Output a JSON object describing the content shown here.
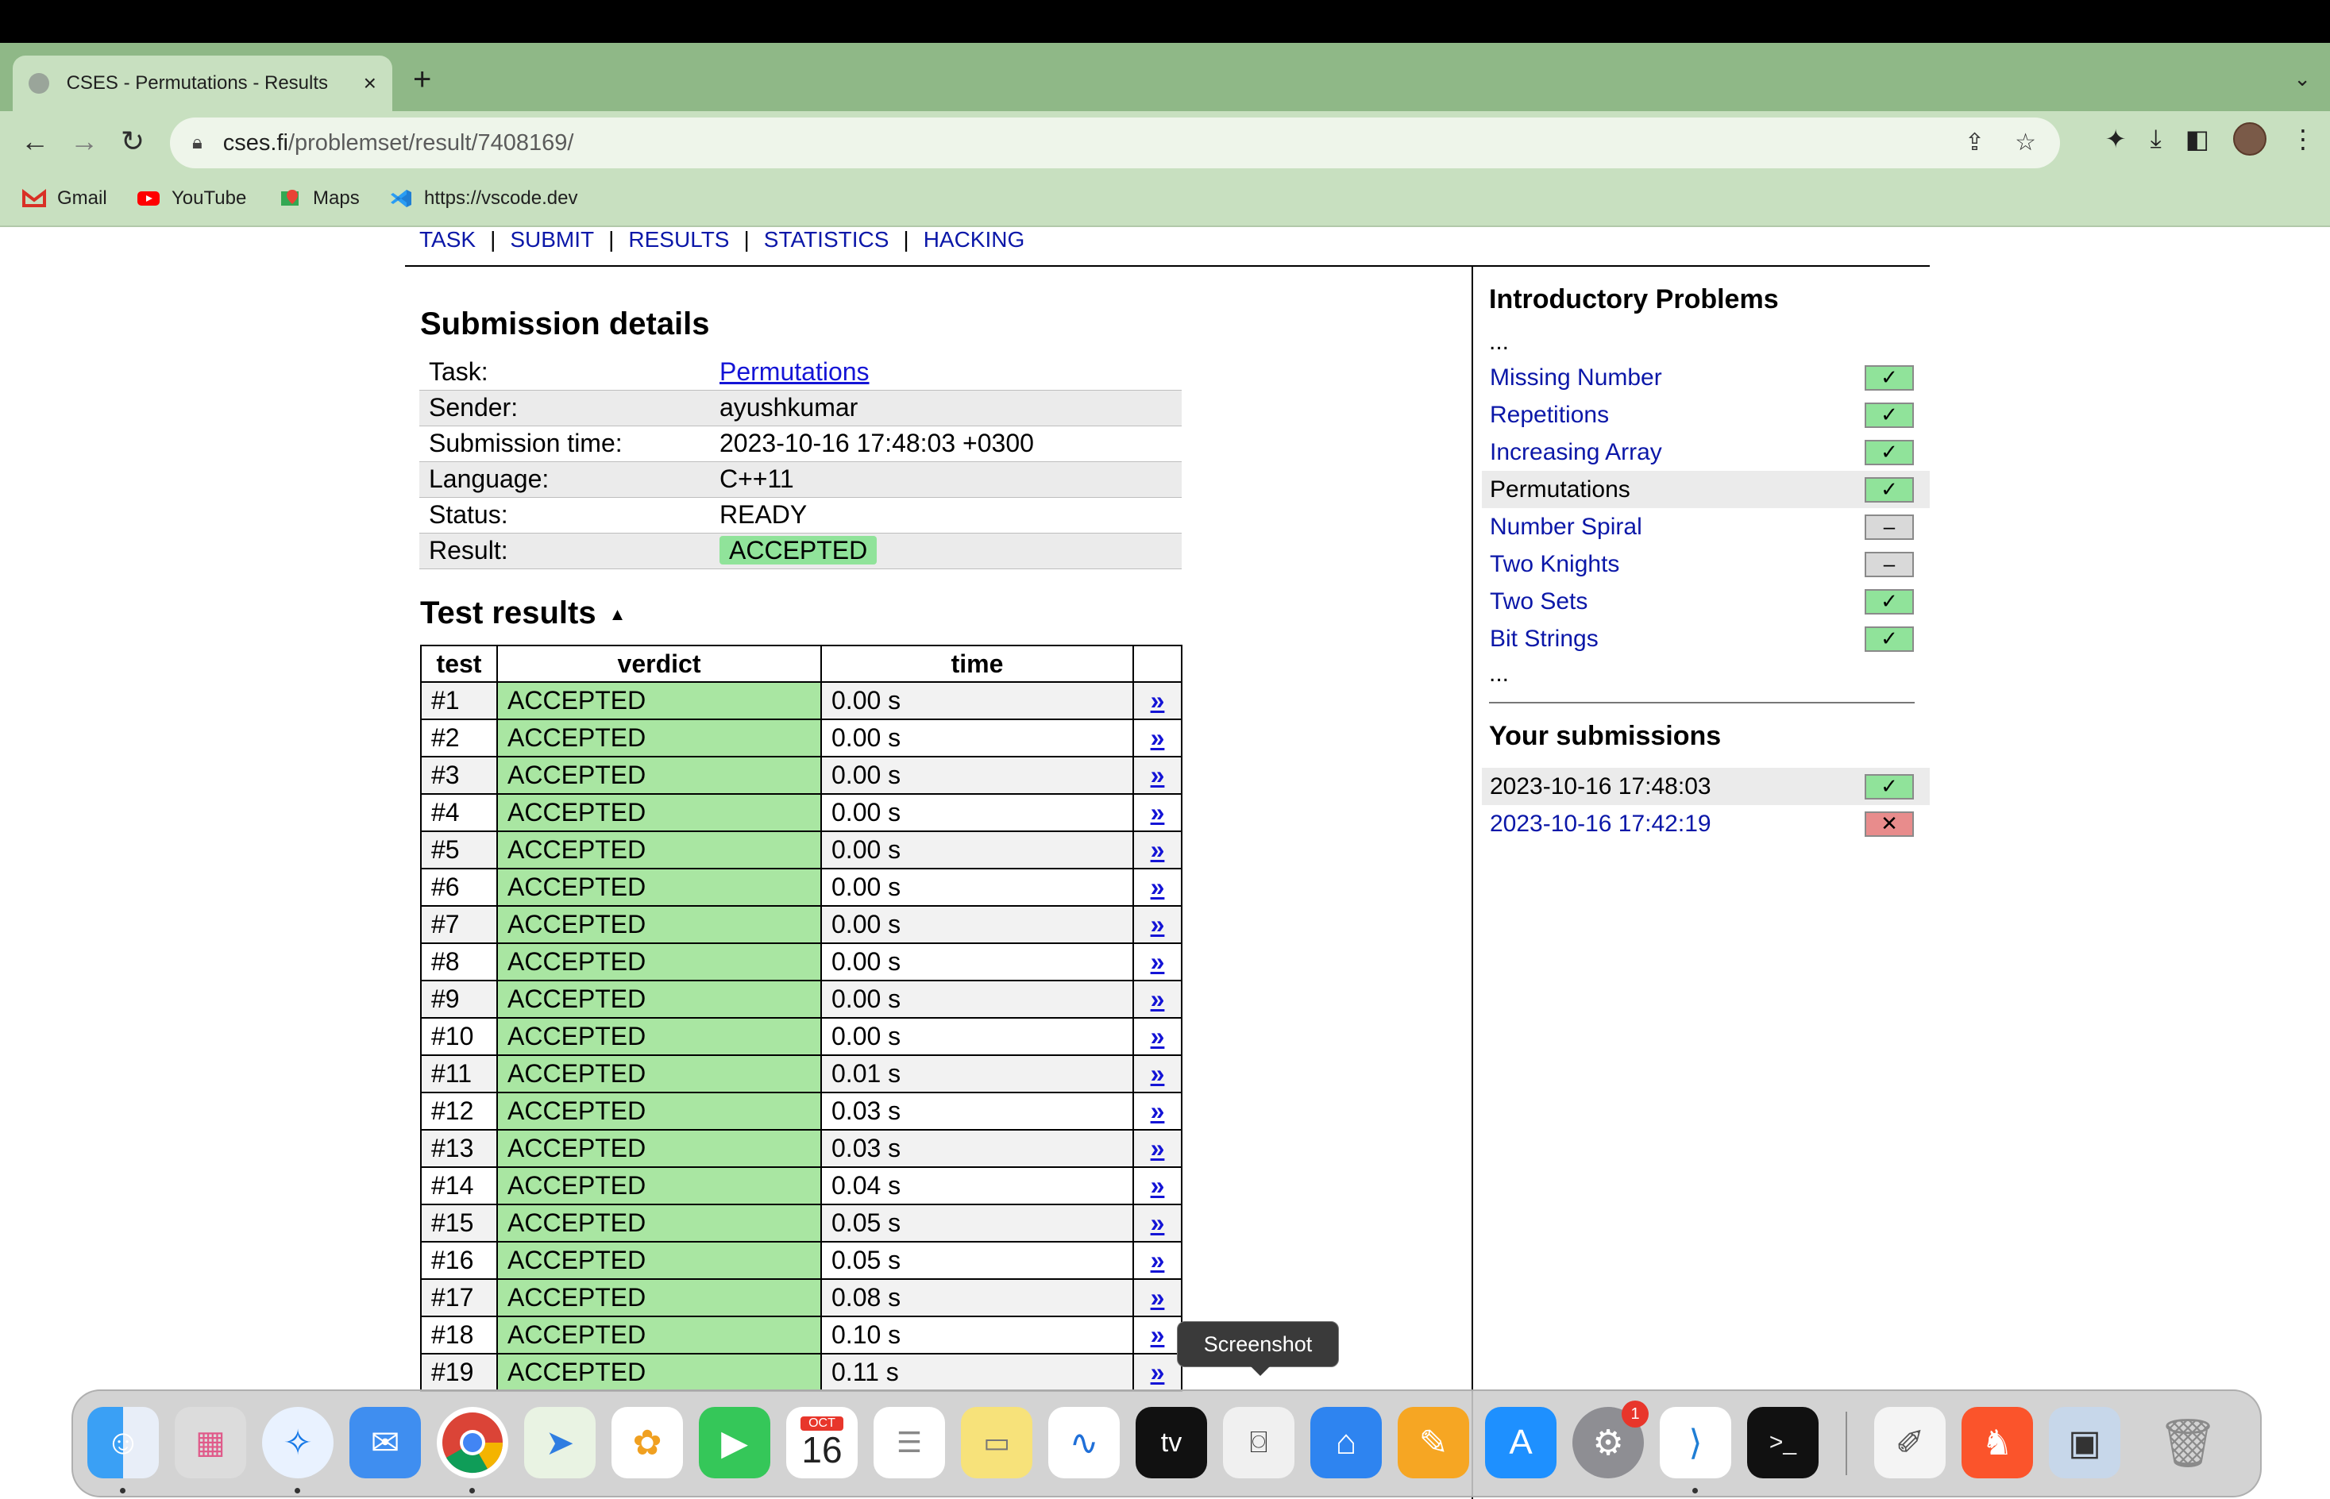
{
  "browser": {
    "tab_title": "CSES - Permutations - Results",
    "tab_close": "×",
    "new_tab": "+",
    "tab_menu": "⌄",
    "url_domain": "cses.fi",
    "url_path": "/problemset/result/7408169/",
    "bookmarks": [
      {
        "label": "Gmail",
        "icon": "gmail-icon",
        "color": "#d93025"
      },
      {
        "label": "YouTube",
        "icon": "youtube-icon",
        "color": "#ff0000"
      },
      {
        "label": "Maps",
        "icon": "maps-icon",
        "color": "#34a853"
      },
      {
        "label": "https://vscode.dev",
        "icon": "vscode-icon",
        "color": "#1f7ed4"
      }
    ]
  },
  "nav": {
    "task": "TASK",
    "submit": "SUBMIT",
    "results": "RESULTS",
    "statistics": "STATISTICS",
    "hacking": "HACKING",
    "sep": "|"
  },
  "submission": {
    "title": "Submission details",
    "rows": [
      {
        "key": "Task:",
        "value": "Permutations"
      },
      {
        "key": "Sender:",
        "value": "ayushkumar"
      },
      {
        "key": "Submission time:",
        "value": "2023-10-16 17:48:03 +0300"
      },
      {
        "key": "Language:",
        "value": "C++11"
      },
      {
        "key": "Status:",
        "value": "READY"
      },
      {
        "key": "Result:",
        "value": "ACCEPTED"
      }
    ]
  },
  "tests": {
    "title": "Test results",
    "sort_arrow": "▲",
    "headers": {
      "test": "test",
      "verdict": "verdict",
      "time": "time"
    },
    "link_glyph": "»",
    "rows": [
      {
        "num": "#1",
        "verdict": "ACCEPTED",
        "time": "0.00 s"
      },
      {
        "num": "#2",
        "verdict": "ACCEPTED",
        "time": "0.00 s"
      },
      {
        "num": "#3",
        "verdict": "ACCEPTED",
        "time": "0.00 s"
      },
      {
        "num": "#4",
        "verdict": "ACCEPTED",
        "time": "0.00 s"
      },
      {
        "num": "#5",
        "verdict": "ACCEPTED",
        "time": "0.00 s"
      },
      {
        "num": "#6",
        "verdict": "ACCEPTED",
        "time": "0.00 s"
      },
      {
        "num": "#7",
        "verdict": "ACCEPTED",
        "time": "0.00 s"
      },
      {
        "num": "#8",
        "verdict": "ACCEPTED",
        "time": "0.00 s"
      },
      {
        "num": "#9",
        "verdict": "ACCEPTED",
        "time": "0.00 s"
      },
      {
        "num": "#10",
        "verdict": "ACCEPTED",
        "time": "0.00 s"
      },
      {
        "num": "#11",
        "verdict": "ACCEPTED",
        "time": "0.01 s"
      },
      {
        "num": "#12",
        "verdict": "ACCEPTED",
        "time": "0.03 s"
      },
      {
        "num": "#13",
        "verdict": "ACCEPTED",
        "time": "0.03 s"
      },
      {
        "num": "#14",
        "verdict": "ACCEPTED",
        "time": "0.04 s"
      },
      {
        "num": "#15",
        "verdict": "ACCEPTED",
        "time": "0.05 s"
      },
      {
        "num": "#16",
        "verdict": "ACCEPTED",
        "time": "0.05 s"
      },
      {
        "num": "#17",
        "verdict": "ACCEPTED",
        "time": "0.08 s"
      },
      {
        "num": "#18",
        "verdict": "ACCEPTED",
        "time": "0.10 s"
      },
      {
        "num": "#19",
        "verdict": "ACCEPTED",
        "time": "0.11 s"
      }
    ]
  },
  "sidebar": {
    "intro_title": "Introductory Problems",
    "ellipsis": "...",
    "problems": [
      {
        "name": "Missing Number",
        "status": "ok",
        "glyph": "✓"
      },
      {
        "name": "Repetitions",
        "status": "ok",
        "glyph": "✓"
      },
      {
        "name": "Increasing Array",
        "status": "ok",
        "glyph": "✓"
      },
      {
        "name": "Permutations",
        "status": "ok",
        "glyph": "✓",
        "current": true
      },
      {
        "name": "Number Spiral",
        "status": "none",
        "glyph": "–"
      },
      {
        "name": "Two Knights",
        "status": "none",
        "glyph": "–"
      },
      {
        "name": "Two Sets",
        "status": "ok",
        "glyph": "✓"
      },
      {
        "name": "Bit Strings",
        "status": "ok",
        "glyph": "✓"
      }
    ],
    "your_title": "Your submissions",
    "submissions": [
      {
        "time": "2023-10-16 17:48:03",
        "status": "ok",
        "glyph": "✓",
        "current": true
      },
      {
        "time": "2023-10-16 17:42:19",
        "status": "bad",
        "glyph": "✕"
      }
    ]
  },
  "tooltip": {
    "text": "Screenshot"
  },
  "dock": {
    "calendar_month": "OCT",
    "calendar_day": "16",
    "settings_badge": "1",
    "tv_label": "tv"
  },
  "colors": {
    "accepted": "#90e39a",
    "link": "#0b17a8",
    "wrong": "#e88c8c",
    "chrome_frame": "#8fb887"
  }
}
